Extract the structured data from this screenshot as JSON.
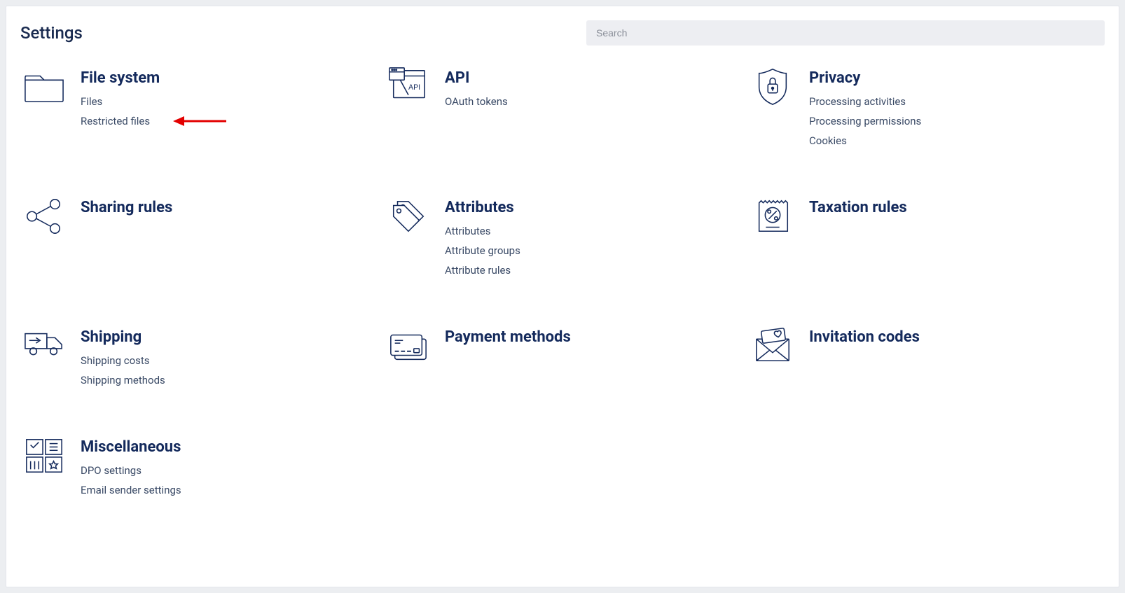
{
  "page_title": "Settings",
  "search_placeholder": "Search",
  "cards": {
    "file_system": {
      "title": "File system",
      "links": [
        "Files",
        "Restricted files"
      ]
    },
    "api": {
      "title": "API",
      "links": [
        "OAuth tokens"
      ]
    },
    "privacy": {
      "title": "Privacy",
      "links": [
        "Processing activities",
        "Processing permissions",
        "Cookies"
      ]
    },
    "sharing_rules": {
      "title": "Sharing rules",
      "links": []
    },
    "attributes": {
      "title": "Attributes",
      "links": [
        "Attributes",
        "Attribute groups",
        "Attribute rules"
      ]
    },
    "taxation_rules": {
      "title": "Taxation rules",
      "links": []
    },
    "shipping": {
      "title": "Shipping",
      "links": [
        "Shipping costs",
        "Shipping methods"
      ]
    },
    "payment_methods": {
      "title": "Payment methods",
      "links": []
    },
    "invitation_codes": {
      "title": "Invitation codes",
      "links": []
    },
    "miscellaneous": {
      "title": "Miscellaneous",
      "links": [
        "DPO settings",
        "Email sender settings"
      ]
    }
  }
}
